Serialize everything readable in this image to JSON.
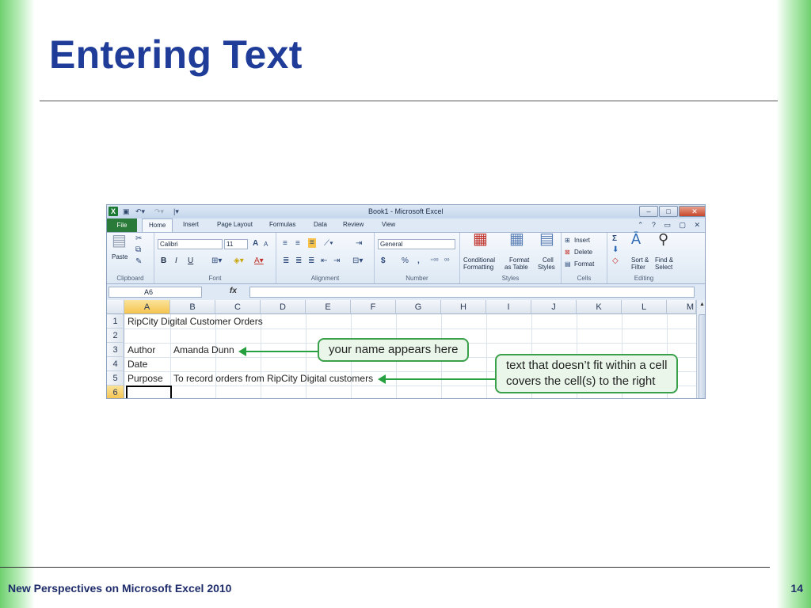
{
  "slide": {
    "title": "Entering Text",
    "footer": "New Perspectives on Microsoft Excel 2010",
    "page_number": "14"
  },
  "excel": {
    "window_title": "Book1 - Microsoft Excel",
    "quick_access": [
      "save-icon",
      "undo-icon",
      "redo-icon",
      "customize-icon"
    ],
    "window_buttons": [
      "minimize",
      "restore",
      "close"
    ],
    "tabs": [
      "File",
      "Home",
      "Insert",
      "Page Layout",
      "Formulas",
      "Data",
      "Review",
      "View"
    ],
    "active_tab": "Home",
    "ribbon": {
      "clipboard": {
        "label": "Clipboard",
        "paste": "Paste"
      },
      "font": {
        "label": "Font",
        "name": "Calibri",
        "size": "11",
        "bold": "B",
        "italic": "I",
        "underline": "U"
      },
      "alignment": {
        "label": "Alignment"
      },
      "number": {
        "label": "Number",
        "format": "General",
        "currency": "$",
        "percent": "%",
        "comma": ","
      },
      "styles": {
        "label": "Styles",
        "conditional": "Conditional",
        "conditional2": "Formatting",
        "format_as": "Format",
        "format_as2": "as Table",
        "cell": "Cell",
        "cell2": "Styles"
      },
      "cells": {
        "label": "Cells",
        "insert": "Insert",
        "delete": "Delete",
        "format": "Format"
      },
      "editing": {
        "label": "Editing",
        "sort": "Sort &",
        "sort2": "Filter",
        "find": "Find &",
        "find2": "Select",
        "sum": "Σ"
      }
    },
    "name_box": "A6",
    "fx": "fx",
    "columns": [
      "A",
      "B",
      "C",
      "D",
      "E",
      "F",
      "G",
      "H",
      "I",
      "J",
      "K",
      "L",
      "M"
    ],
    "rows": [
      "1",
      "2",
      "3",
      "4",
      "5",
      "6"
    ],
    "cells": {
      "a1": "RipCity Digital Customer Orders",
      "a3": "Author",
      "b3": "Amanda Dunn",
      "a4": "Date",
      "a5": "Purpose",
      "b5": "To record orders from RipCity Digital customers"
    },
    "callouts": {
      "name": "your name appears here",
      "overflow_line1": "text that doesn’t fit within a cell",
      "overflow_line2": "covers the cell(s) to the right"
    },
    "colors": {
      "accent": "#1f3c99",
      "callout_border": "#3aa04a",
      "file_tab": "#2a7a39"
    }
  }
}
